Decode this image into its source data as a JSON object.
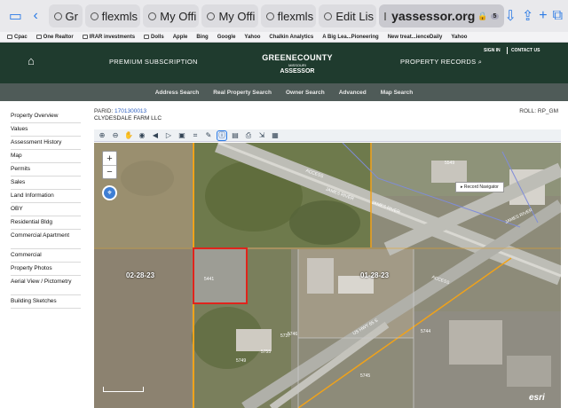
{
  "browser": {
    "tabs": [
      {
        "label": "Gr"
      },
      {
        "label": "flexmls"
      },
      {
        "label": "My Offi"
      },
      {
        "label": "My Offi"
      },
      {
        "label": "flexmls"
      },
      {
        "label": "Edit Lis"
      }
    ],
    "active_tab": {
      "label": "yassessor.org",
      "badge": "5"
    },
    "bookmarks": [
      "Cpac",
      "One Realtor",
      "IRAR investments",
      "Dolls",
      "Apple",
      "Bing",
      "Google",
      "Yahoo",
      "Chalkin Analytics",
      "A Big Lea...Pioneering",
      "New treat...ienceDaily",
      "Yahoo"
    ]
  },
  "site": {
    "premium": "PREMIUM SUBSCRIPTION",
    "logo_line1": "GREENECOUNTY",
    "logo_line2": "MISSOURI",
    "logo_line3": "ASSESSOR",
    "property_records": "PROPERTY RECORDS",
    "signin": "SIGN IN",
    "contact": "CONTACT US",
    "subnav": [
      "Address Search",
      "Real Property Search",
      "Owner Search",
      "Advanced",
      "Map Search"
    ]
  },
  "sidebar": {
    "items": [
      "Property Overview",
      "Values",
      "Assessment History",
      "Map",
      "Permits",
      "Sales",
      "Land Information",
      "OBY",
      "Residential Bldg",
      "Commercial Apartment",
      "Commercial",
      "Property Photos",
      "Aerial View / Pictometry",
      "Building Sketches"
    ]
  },
  "parcel": {
    "parid_label": "PARID:",
    "parid": "1701300013",
    "roll": "ROLL: RP_GM",
    "owner": "CLYDESDALE FARM LLC"
  },
  "map": {
    "record_navigator": "Record Navigator",
    "date_left": "02-28-23",
    "date_right": "01-28-23",
    "parcel_number": "5441",
    "esri": "esri",
    "labels": [
      "5549",
      "5737",
      "5749",
      "5755",
      "5746",
      "5745",
      "5744"
    ],
    "road_labels": [
      "ACCESS",
      "JAMES RIVER",
      "JAMES RIVER",
      "ACCESS",
      "JAMES RIVER",
      "US HWY 65 S"
    ]
  },
  "colors": {
    "site_green": "#1f3b2e",
    "subnav_gray": "#4f5b58",
    "link_blue": "#2c5fbf",
    "parcel_outline": "#e0241c",
    "road_orange": "#f0a21a"
  }
}
